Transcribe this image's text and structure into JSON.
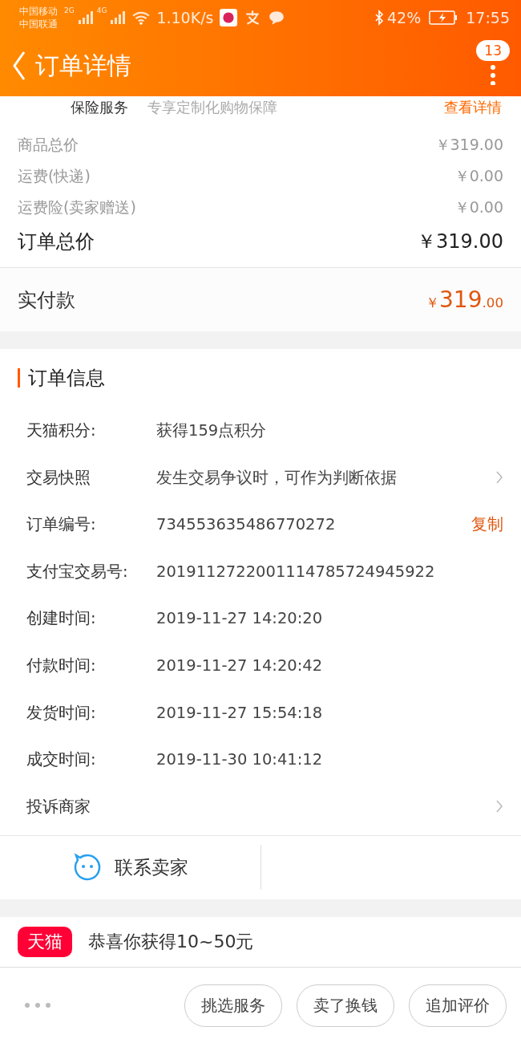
{
  "status_bar": {
    "carriers": [
      "中国移动",
      "中国联通"
    ],
    "net_badges": [
      "2G",
      "4G"
    ],
    "speed": "1.10K/s",
    "battery": "42%",
    "time": "17:55"
  },
  "header": {
    "title": "订单详情",
    "badge": "13"
  },
  "insurance": {
    "label": "保险服务",
    "desc": "专享定制化购物保障",
    "link": "查看详情"
  },
  "prices": [
    {
      "label": "商品总价",
      "value": "￥319.00",
      "kind": "minor"
    },
    {
      "label": "运费(快递)",
      "value": "￥0.00",
      "kind": "minor"
    },
    {
      "label": "运费险(卖家赠送)",
      "value": "￥0.00",
      "kind": "minor"
    },
    {
      "label": "订单总价",
      "value": "￥319.00",
      "kind": "total"
    }
  ],
  "paid": {
    "label": "实付款",
    "currency": "￥",
    "integer": "319",
    "decimals": ".00"
  },
  "order_info": {
    "title": "订单信息",
    "rows": [
      {
        "label": "天猫积分:",
        "value": "获得159点积分",
        "kind": "plain"
      },
      {
        "label": "交易快照",
        "value": "发生交易争议时，可作为判断依据",
        "kind": "link"
      },
      {
        "label": "订单编号:",
        "value": "734553635486770272",
        "kind": "copy",
        "action": "复制"
      },
      {
        "label": "支付宝交易号:",
        "value": "2019112722001114785724945922",
        "kind": "plain"
      },
      {
        "label": "创建时间:",
        "value": "2019-11-27 14:20:20",
        "kind": "plain"
      },
      {
        "label": "付款时间:",
        "value": "2019-11-27 14:20:42",
        "kind": "plain"
      },
      {
        "label": "发货时间:",
        "value": "2019-11-27 15:54:18",
        "kind": "plain"
      },
      {
        "label": "成交时间:",
        "value": "2019-11-30 10:41:12",
        "kind": "plain"
      },
      {
        "label": "投诉商家",
        "kind": "link"
      }
    ]
  },
  "contact": {
    "label": "联系卖家"
  },
  "promo": {
    "logo": "天猫",
    "text": "恭喜你获得10~50元"
  },
  "bottom_bar": {
    "buttons": [
      "挑选服务",
      "卖了换钱",
      "追加评价"
    ]
  }
}
